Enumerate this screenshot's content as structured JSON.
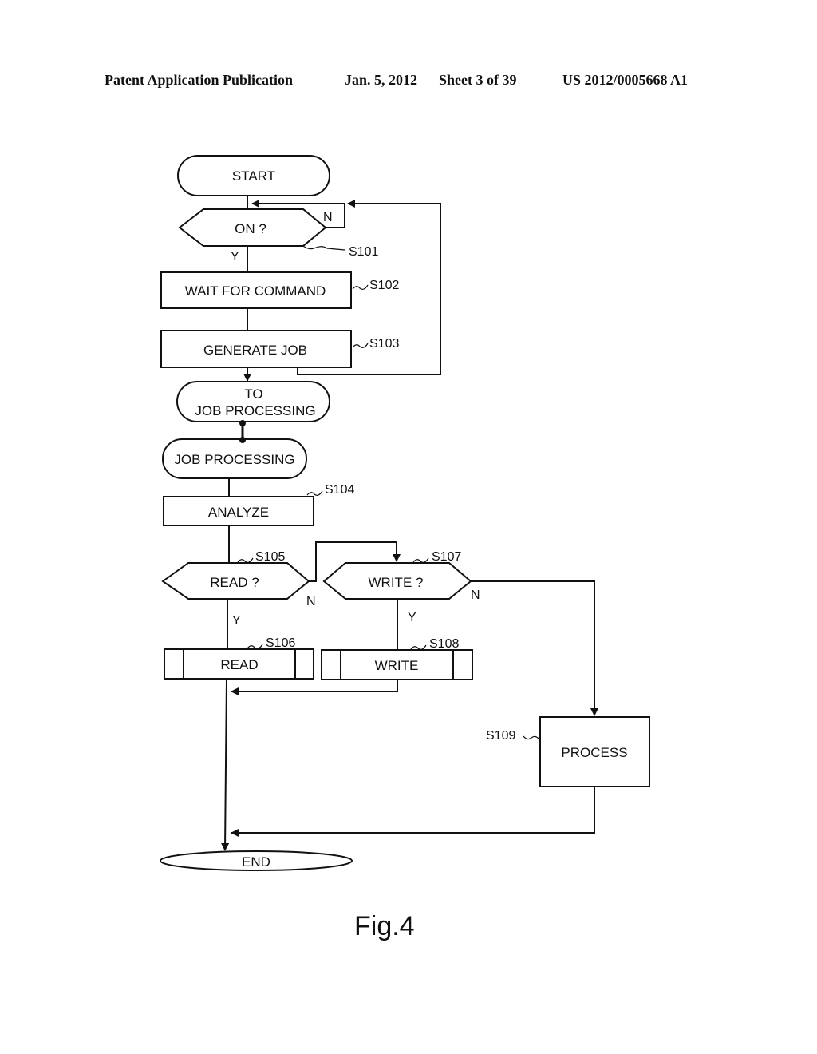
{
  "header": {
    "publication": "Patent Application Publication",
    "date": "Jan. 5, 2012",
    "sheet": "Sheet 3 of 39",
    "number": "US 2012/0005668 A1"
  },
  "figure_label": "Fig.4",
  "nodes": {
    "start": "START",
    "on": "ON ?",
    "wait": "WAIT FOR COMMAND",
    "generate": "GENERATE JOB",
    "to_job_1": "TO",
    "to_job_2": "JOB PROCESSING",
    "job_processing": "JOB PROCESSING",
    "analyze": "ANALYZE",
    "read_q": "READ ?",
    "write_q": "WRITE ?",
    "read": "READ",
    "write": "WRITE",
    "process": "PROCESS",
    "end": "END"
  },
  "steps": {
    "s101": "S101",
    "s102": "S102",
    "s103": "S103",
    "s104": "S104",
    "s105": "S105",
    "s106": "S106",
    "s107": "S107",
    "s108": "S108",
    "s109": "S109"
  },
  "branches": {
    "yes": "Y",
    "no": "N"
  }
}
